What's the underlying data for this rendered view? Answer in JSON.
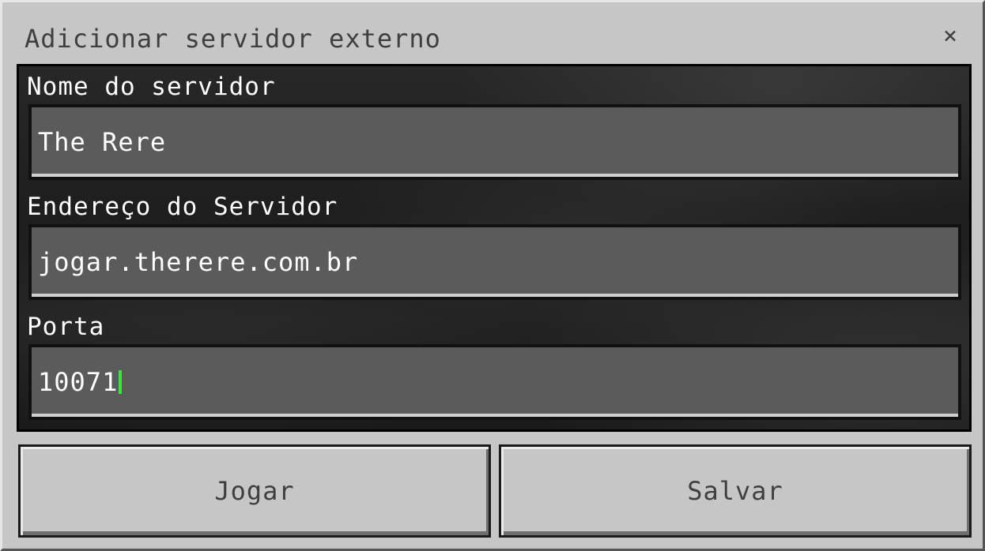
{
  "dialog": {
    "title": "Adicionar servidor externo",
    "close_icon": "×"
  },
  "form": {
    "server_name": {
      "label": "Nome do servidor",
      "value": "The Rere"
    },
    "server_address": {
      "label": "Endereço do Servidor",
      "value": "jogar.therere.com.br"
    },
    "port": {
      "label": "Porta",
      "value": "10071"
    }
  },
  "buttons": {
    "play_label": "Jogar",
    "save_label": "Salvar"
  },
  "colors": {
    "panel_bg": "#c6c6c6",
    "field_bg": "#5b5b5b",
    "caret": "#3ee33e",
    "title_text": "#3f3f3f"
  }
}
